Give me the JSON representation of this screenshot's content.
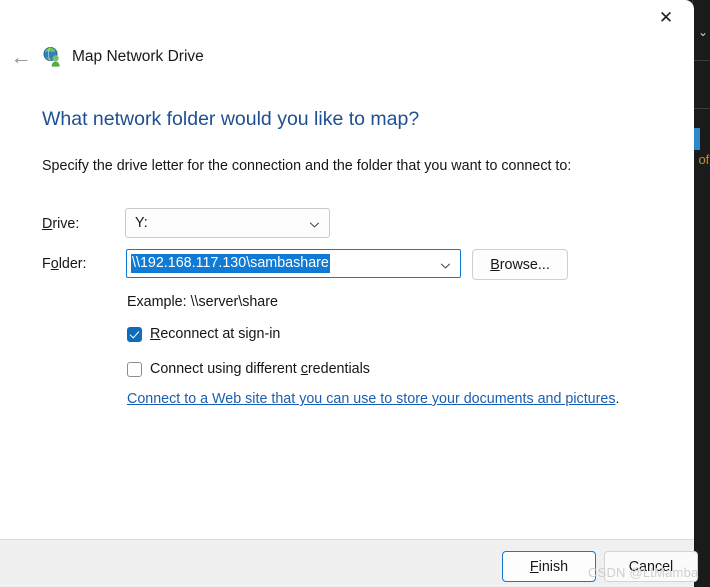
{
  "window": {
    "title": "Map Network Drive",
    "title_icon": "network-drive-globe-person-icon",
    "close_label": "✕",
    "back_label": "←"
  },
  "content": {
    "heading": "What network folder would you like to map?",
    "subtext": "Specify the drive letter for the connection and the folder that you want to connect to:",
    "drive": {
      "label_pre": "D",
      "label_post": "rive:",
      "value": "Y:"
    },
    "folder": {
      "label_pre_a": "F",
      "label_accel": "o",
      "label_post": "lder:",
      "value": "\\\\192.168.117.130\\sambashare",
      "selected": true,
      "browse_accel": "B",
      "browse_rest": "rowse..."
    },
    "example": "Example: \\\\server\\share",
    "checkboxes": [
      {
        "name": "reconnect-at-sign-in",
        "accel": "R",
        "label_rest": "econnect at sign-in",
        "checked": true
      },
      {
        "name": "connect-using-different-credentials",
        "label_pre": "Connect using different ",
        "accel": "c",
        "label_rest": "redentials",
        "checked": false
      }
    ],
    "weblink": {
      "text": "Connect to a Web site that you can use to store your documents and pictures",
      "trailing": "."
    }
  },
  "footer": {
    "finish_accel": "F",
    "finish_rest": "inish",
    "cancel_label": "Cancel"
  },
  "watermark": "CSDN @LtMamba",
  "background": {
    "of_fragment": "of",
    "chevron": "⌄"
  },
  "colors": {
    "accent_blue": "#0f7bd4",
    "heading_blue": "#1d4f91",
    "link_blue": "#1a5fb4",
    "checkbox_blue": "#0f6cbd",
    "footer_bg": "#f0f0f0",
    "dialog_bg": "#ffffff",
    "desktop_dark": "#1e1e1e"
  }
}
